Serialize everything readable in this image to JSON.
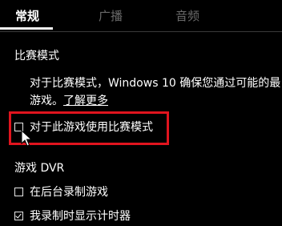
{
  "tabs": [
    {
      "label": "常规",
      "active": true
    },
    {
      "label": "广播",
      "active": false
    },
    {
      "label": "音频",
      "active": false
    }
  ],
  "game_mode": {
    "title": "比赛模式",
    "description_line1": "对于比赛模式，Windows 10 确保您通过可能的最",
    "description_line2_prefix": "游戏。",
    "learn_more_link": "了解更多",
    "checkbox_label": "对于此游戏使用比赛模式",
    "checkbox_checked": false
  },
  "game_dvr": {
    "title": "游戏 DVR",
    "options": [
      {
        "label": "在后台录制游戏",
        "checked": false
      },
      {
        "label": "我录制时显示计时器",
        "checked": true
      }
    ]
  },
  "colors": {
    "background": "#000000",
    "text": "#ffffff",
    "inactive_tab": "#6a6a6a",
    "highlight": "#e0141e"
  }
}
